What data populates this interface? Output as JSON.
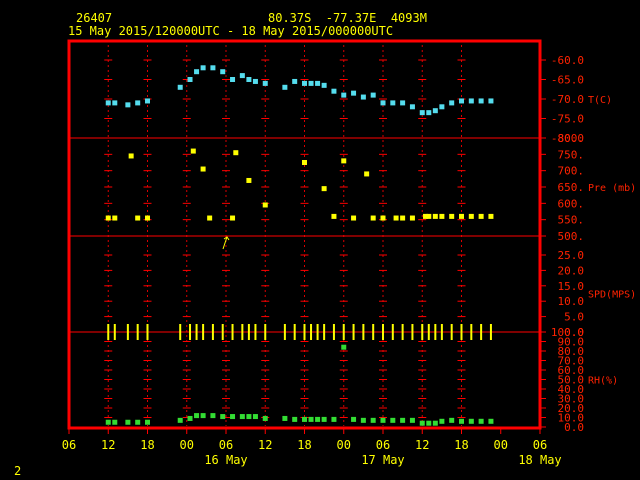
{
  "header": {
    "station": "26407",
    "location": "80.37S  -77.37E  4093M",
    "period": "15 May 2015/120000UTC - 18 May 2015/000000UTC"
  },
  "footer": {
    "page_number": "2"
  },
  "colors": {
    "frame": "#ff0000",
    "temperature": "#55ddee",
    "pressure": "#ffff00",
    "wind": "#ffff00",
    "humidity": "#33dd33",
    "text": "#ffff00",
    "label": "#ff2200"
  },
  "chart_data": {
    "type": "scatter",
    "x_axis": {
      "unit": "hours after 15 May 2015 12 UTC",
      "range": [
        -6,
        66
      ],
      "tick_labels": [
        "06",
        "12",
        "18",
        "00",
        "06",
        "12",
        "18",
        "00",
        "06",
        "12",
        "18",
        "00",
        "06"
      ],
      "date_labels": [
        "16 May",
        "17 May",
        "18 May"
      ]
    },
    "panels": [
      {
        "label": "T(C)",
        "ylim": [
          -80,
          -60
        ],
        "tick_labels": [
          "-60.0",
          "-65.0",
          "-70.0",
          "-75.0",
          "-80.0"
        ],
        "series": [
          {
            "values": [
              [
                0,
                -71
              ],
              [
                1,
                -71
              ],
              [
                3,
                -71.5
              ],
              [
                4.5,
                -71
              ],
              [
                6,
                -70.5
              ],
              [
                11,
                -67
              ],
              [
                12.5,
                -65
              ],
              [
                13.5,
                -63
              ],
              [
                14.5,
                -62
              ],
              [
                16,
                -62
              ],
              [
                17.5,
                -63
              ],
              [
                19,
                -65
              ],
              [
                20.5,
                -64
              ],
              [
                21.5,
                -65
              ],
              [
                22.5,
                -65.5
              ],
              [
                24,
                -66
              ],
              [
                27,
                -67
              ],
              [
                28.5,
                -65.5
              ],
              [
                30,
                -66
              ],
              [
                31,
                -66
              ],
              [
                32,
                -66
              ],
              [
                33,
                -66.5
              ],
              [
                34.5,
                -68
              ],
              [
                36,
                -69
              ],
              [
                37.5,
                -68.5
              ],
              [
                39,
                -69.5
              ],
              [
                40.5,
                -69
              ],
              [
                42,
                -71
              ],
              [
                43.5,
                -71
              ],
              [
                45,
                -71
              ],
              [
                46.5,
                -72
              ],
              [
                48,
                -73.5
              ],
              [
                49,
                -73.5
              ],
              [
                50,
                -73
              ],
              [
                51,
                -72
              ],
              [
                52.5,
                -71
              ],
              [
                54,
                -70.5
              ],
              [
                55.5,
                -70.5
              ],
              [
                57,
                -70.5
              ],
              [
                58.5,
                -70.5
              ]
            ]
          }
        ]
      },
      {
        "label": "Pre (mb)",
        "ylim": [
          500,
          800
        ],
        "tick_labels": [
          "800.",
          "750.",
          "700.",
          "650.",
          "600.",
          "550.",
          "500."
        ],
        "series": [
          {
            "values": [
              [
                0,
                555
              ],
              [
                1,
                555
              ],
              [
                3.5,
                745
              ],
              [
                4.5,
                555
              ],
              [
                6,
                555
              ],
              [
                13,
                760
              ],
              [
                14.5,
                705
              ],
              [
                15.5,
                555
              ],
              [
                19,
                555
              ],
              [
                19.5,
                755
              ],
              [
                21.5,
                670
              ],
              [
                24,
                595
              ],
              [
                30,
                725
              ],
              [
                33,
                645
              ],
              [
                34.5,
                560
              ],
              [
                36,
                730
              ],
              [
                37.5,
                555
              ],
              [
                39.5,
                690
              ],
              [
                40.5,
                555
              ],
              [
                42,
                555
              ],
              [
                44,
                555
              ],
              [
                45,
                555
              ],
              [
                46.5,
                555
              ],
              [
                48.5,
                560
              ],
              [
                49,
                560
              ],
              [
                50,
                560
              ],
              [
                51,
                560
              ],
              [
                52.5,
                560
              ],
              [
                54,
                560
              ],
              [
                55.5,
                560
              ],
              [
                57,
                560
              ],
              [
                58.5,
                560
              ]
            ]
          }
        ]
      },
      {
        "label": "SPD(MPS)",
        "ylim": [
          0,
          25
        ],
        "tick_labels": [
          "25.0",
          "20.0",
          "15.0",
          "10.0",
          "5.0",
          "0.0"
        ],
        "series": [
          {
            "values": [
              [
                0,
                0
              ],
              [
                1,
                0
              ],
              [
                3,
                0
              ],
              [
                4.5,
                0
              ],
              [
                6,
                0
              ],
              [
                11,
                0
              ],
              [
                12.5,
                0
              ],
              [
                13.5,
                0
              ],
              [
                14.5,
                0
              ],
              [
                16,
                0
              ],
              [
                17.5,
                0
              ],
              [
                19,
                0
              ],
              [
                20.5,
                0
              ],
              [
                21.5,
                0
              ],
              [
                22.5,
                0
              ],
              [
                24,
                0
              ],
              [
                27,
                0
              ],
              [
                28.5,
                0
              ],
              [
                30,
                0
              ],
              [
                31,
                0
              ],
              [
                32,
                0
              ],
              [
                33,
                0
              ],
              [
                34.5,
                0
              ],
              [
                36,
                0
              ],
              [
                37.5,
                0
              ],
              [
                39,
                0
              ],
              [
                40.5,
                0
              ],
              [
                42,
                0
              ],
              [
                43.5,
                0
              ],
              [
                45,
                0
              ],
              [
                46.5,
                0
              ],
              [
                48,
                0
              ],
              [
                49,
                0
              ],
              [
                50,
                0
              ],
              [
                51,
                0
              ],
              [
                52.5,
                0
              ],
              [
                54,
                0
              ],
              [
                55.5,
                0
              ],
              [
                57,
                0
              ],
              [
                58.5,
                0
              ]
            ]
          }
        ]
      },
      {
        "label": "RH(%)",
        "ylim": [
          0,
          100
        ],
        "tick_labels": [
          "100.0",
          "90.0",
          "80.0",
          "70.0",
          "60.0",
          "50.0",
          "40.0",
          "30.0",
          "20.0",
          "10.0",
          "0.0"
        ],
        "series": [
          {
            "values": [
              [
                0,
                5
              ],
              [
                1,
                5
              ],
              [
                3,
                5
              ],
              [
                4.5,
                5
              ],
              [
                6,
                5
              ],
              [
                11,
                7
              ],
              [
                12.5,
                9
              ],
              [
                13.5,
                12
              ],
              [
                14.5,
                12
              ],
              [
                16,
                12
              ],
              [
                17.5,
                11
              ],
              [
                19,
                11
              ],
              [
                20.5,
                11
              ],
              [
                21.5,
                11
              ],
              [
                22.5,
                11
              ],
              [
                24,
                9
              ],
              [
                27,
                9
              ],
              [
                28.5,
                8
              ],
              [
                30,
                8
              ],
              [
                31,
                8
              ],
              [
                32,
                8
              ],
              [
                33,
                8
              ],
              [
                34.5,
                8
              ],
              [
                36,
                84
              ],
              [
                37.5,
                8
              ],
              [
                39,
                7
              ],
              [
                40.5,
                7
              ],
              [
                42,
                7
              ],
              [
                43.5,
                7
              ],
              [
                45,
                7
              ],
              [
                46.5,
                7
              ],
              [
                48,
                4
              ],
              [
                49,
                4
              ],
              [
                50,
                4
              ],
              [
                51,
                6
              ],
              [
                52.5,
                7
              ],
              [
                54,
                6
              ],
              [
                55.5,
                6
              ],
              [
                57,
                6
              ],
              [
                58.5,
                6
              ]
            ]
          }
        ]
      }
    ],
    "wind_arrows": [
      {
        "x": 18
      }
    ]
  }
}
